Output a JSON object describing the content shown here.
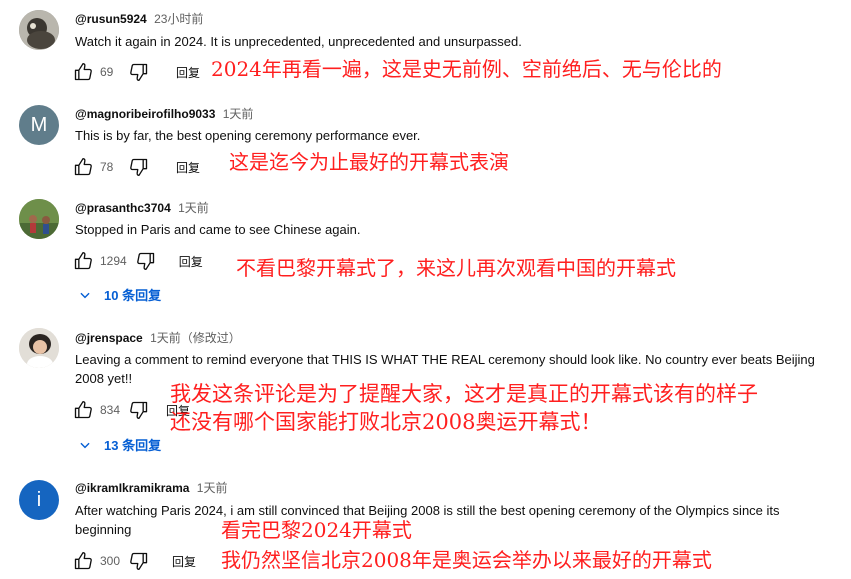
{
  "comments": [
    {
      "author": "@rusun5924",
      "time": "23小时前",
      "text": "Watch it again in 2024. It is unprecedented, unprecedented and unsurpassed.",
      "likes": "69",
      "reply_label": "回复",
      "annotation": [
        "2024年再看一遍，这是史无前例、空前绝后、无与伦比的"
      ]
    },
    {
      "author": "@magnoribeirofilho9033",
      "time": "1天前",
      "avatar_letter": "M",
      "avatar_color": "#607d8b",
      "text": "This is by far, the best opening ceremony performance ever.",
      "likes": "78",
      "reply_label": "回复",
      "annotation": [
        "这是迄今为止最好的开幕式表演"
      ]
    },
    {
      "author": "@prasanthc3704",
      "time": "1天前",
      "text": "Stopped in Paris and came to see Chinese again.",
      "likes": "1294",
      "reply_label": "回复",
      "replies": "10 条回复",
      "annotation": [
        "不看巴黎开幕式了，来这儿再次观看中国的开幕式"
      ]
    },
    {
      "author": "@jrenspace",
      "time": "1天前（修改过）",
      "text": "Leaving a comment to remind everyone that THIS IS WHAT THE REAL ceremony should look like. No country ever beats Beijing 2008 yet!!",
      "likes": "834",
      "reply_label": "回复",
      "replies": "13 条回复",
      "annotation": [
        "我发这条评论是为了提醒大家，这才是真正的开幕式该有的样子",
        "还没有哪个国家能打败北京2008奥运开幕式！"
      ]
    },
    {
      "author": "@ikramIkramikrama",
      "time": "1天前",
      "avatar_letter": "i",
      "avatar_color": "#1565c0",
      "text": "After watching Paris 2024, i am still convinced that Beijing 2008 is still the best opening ceremony of the Olympics since its beginning",
      "likes": "300",
      "reply_label": "回复",
      "annotation": [
        "看完巴黎2024开幕式",
        "我仍然坚信北京2008年是奥运会举办以来最好的开幕式"
      ]
    }
  ]
}
